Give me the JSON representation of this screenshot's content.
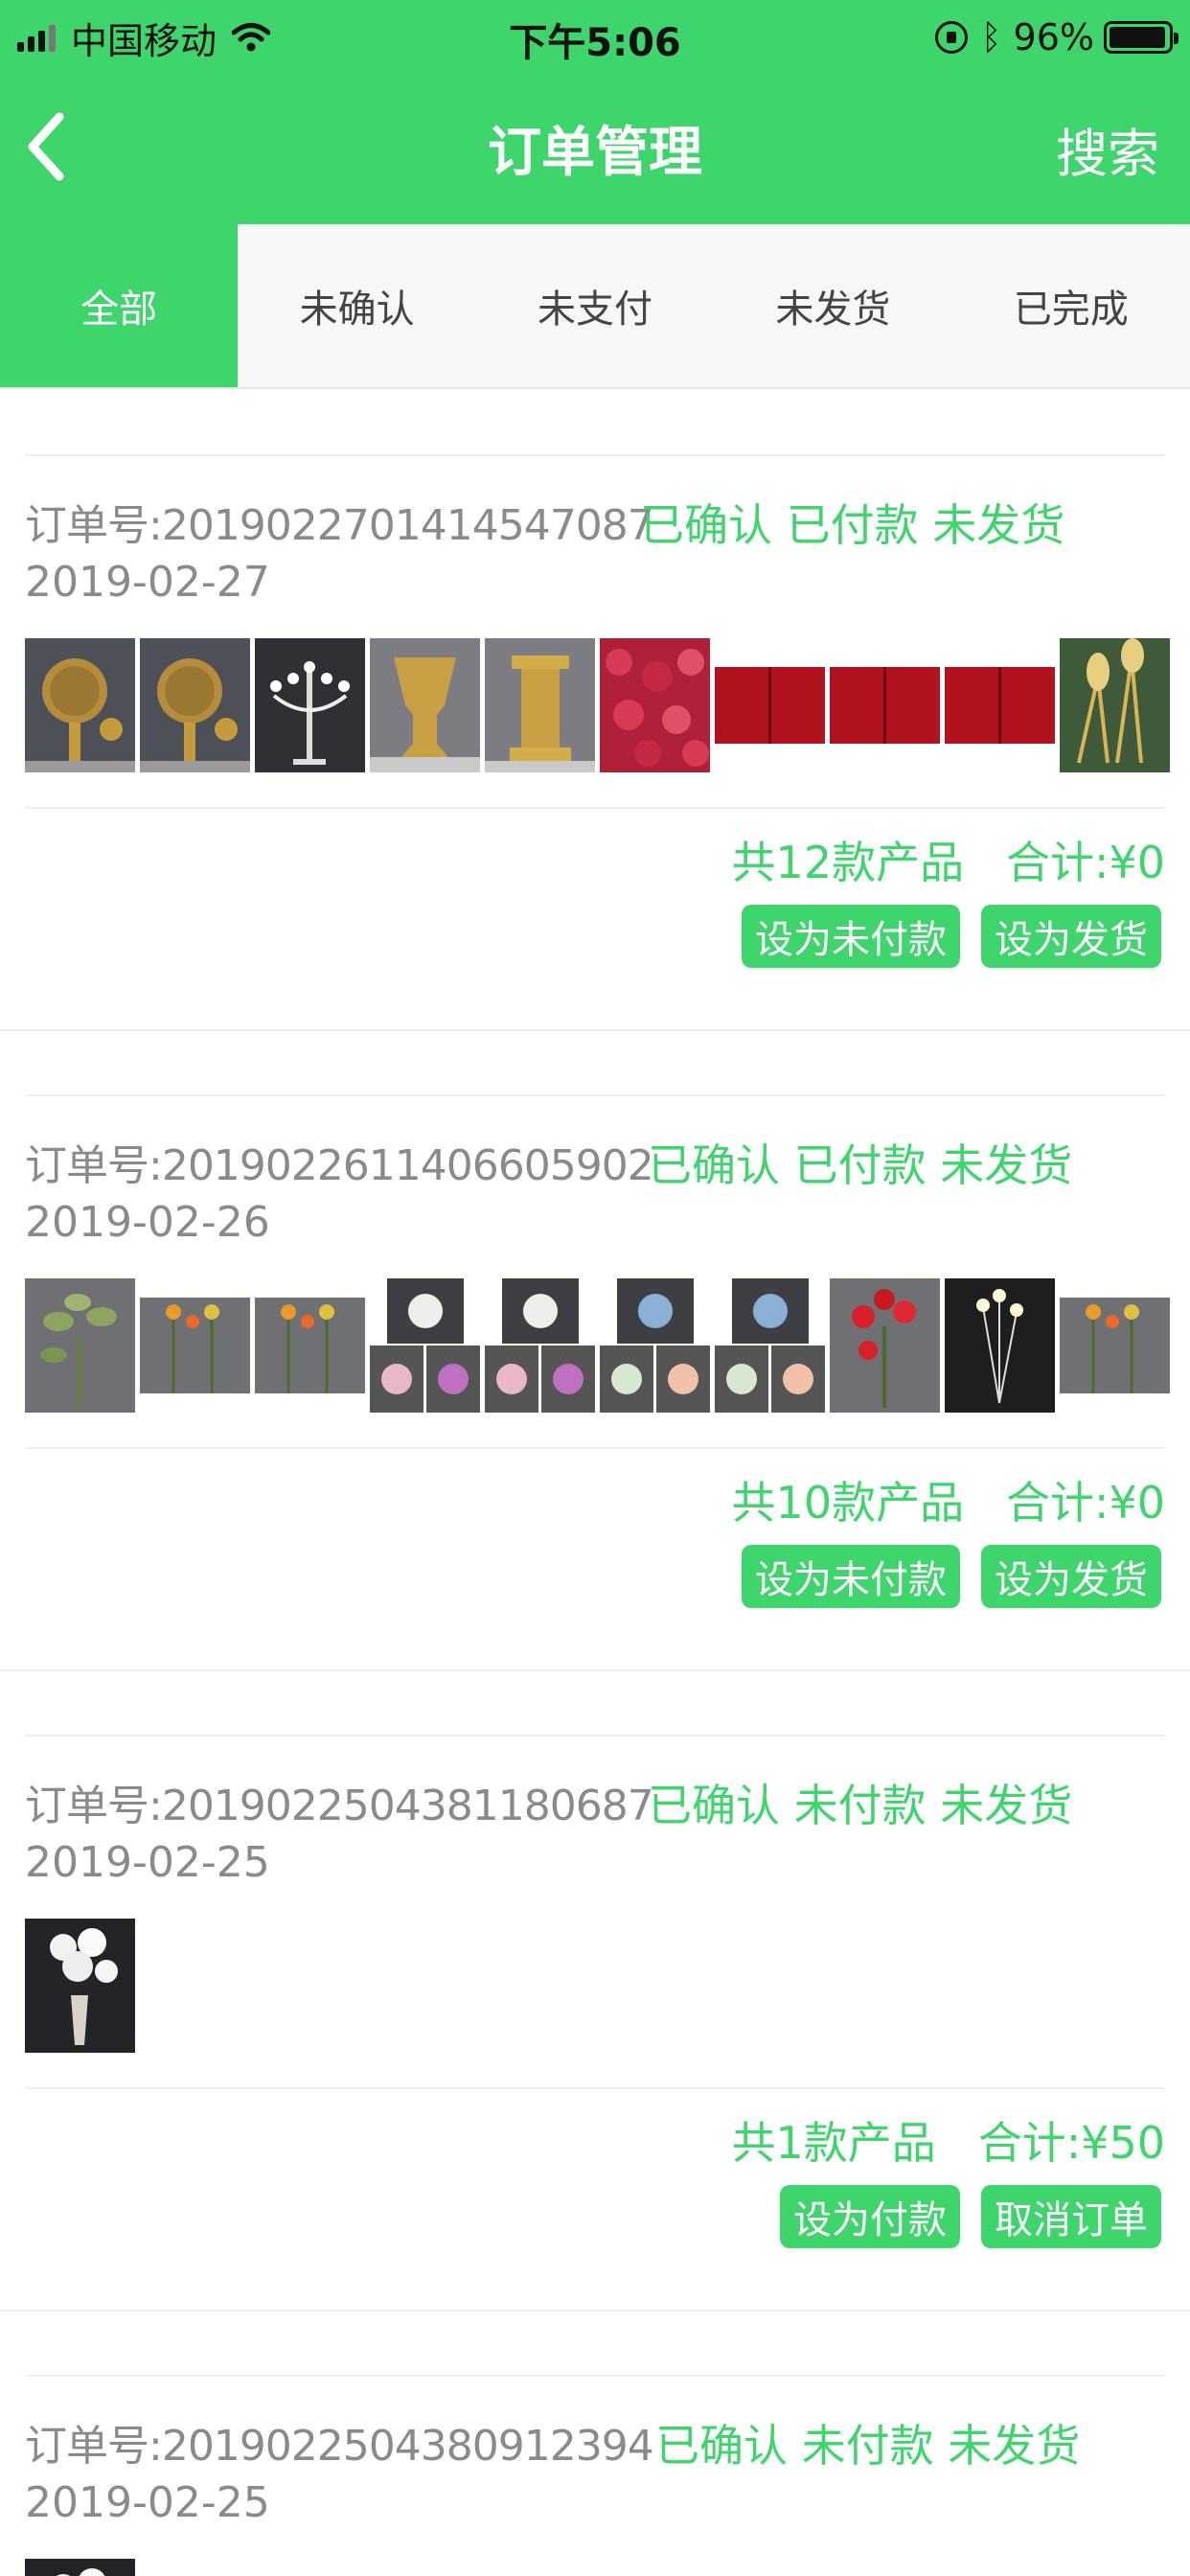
{
  "status_bar": {
    "carrier": "中国移动",
    "time": "下午5:06",
    "battery": "96%",
    "battery_level": 0.96
  },
  "nav": {
    "title": "订单管理",
    "search_label": "搜索"
  },
  "tabs": [
    {
      "label": "全部",
      "active": true
    },
    {
      "label": "未确认",
      "active": false
    },
    {
      "label": "未支付",
      "active": false
    },
    {
      "label": "未发货",
      "active": false
    },
    {
      "label": "已完成",
      "active": false
    }
  ],
  "orders": [
    {
      "order_no": "订单号:2019022701414547087",
      "status": "已确认 已付款 未发货",
      "date": "2019-02-27",
      "thumb_icons": [
        "lantern-tree-image",
        "lantern-tree-image",
        "candelabra-image",
        "gold-vase-image",
        "gold-column-image",
        "rose-petals-image",
        "red-curtain-image",
        "red-curtain-image",
        "red-curtain-image",
        "gold-lily-stand-image"
      ],
      "count_text": "共12款产品",
      "total_text": "合计:¥0",
      "actions": [
        "设为未付款",
        "设为发货"
      ]
    },
    {
      "order_no": "订单号:2019022611406605902",
      "status": "已确认 已付款 未发货",
      "date": "2019-02-26",
      "thumb_icons": [
        "green-flower-image",
        "orange-flower-image",
        "orange-flower-image",
        "white-purple-flower-image",
        "white-purple-flower-image",
        "blue-flower-image",
        "blue-flower-image",
        "red-flower-image",
        "led-flower-image",
        "orange-flower-image"
      ],
      "count_text": "共10款产品",
      "total_text": "合计:¥0",
      "actions": [
        "设为未付款",
        "设为发货"
      ]
    },
    {
      "order_no": "订单号:2019022504381180687",
      "status": "已确认 未付款 未发货",
      "date": "2019-02-25",
      "thumb_icons": [
        "white-flower-vase-image"
      ],
      "count_text": "共1款产品",
      "total_text": "合计:¥50",
      "actions": [
        "设为付款",
        "取消订单"
      ]
    },
    {
      "order_no": "订单号:2019022504380912394",
      "status": "已确认 未付款 未发货",
      "date": "2019-02-25",
      "thumb_icons": [
        "white-flower-vase-image"
      ],
      "count_text": "",
      "total_text": "",
      "actions": []
    }
  ],
  "colors": {
    "accent": "#3dd56c",
    "text_grey": "#8a8a8a",
    "tab_bg": "#f7f7f7"
  }
}
